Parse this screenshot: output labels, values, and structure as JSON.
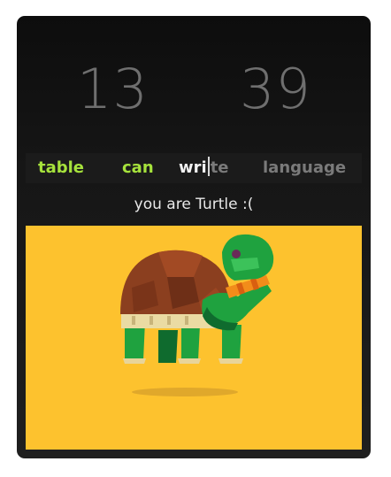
{
  "stats": {
    "left_value": "13",
    "right_value": "39"
  },
  "words": {
    "done": [
      "table",
      "can"
    ],
    "current_typed": "wri",
    "current_remaining": "te",
    "upcoming": "language"
  },
  "result": {
    "message": "you are Turtle :("
  },
  "illustration": {
    "icon": "turtle-icon",
    "background_color": "#fdc22e"
  },
  "colors": {
    "done_word": "#a6e23c",
    "pending_word": "#7a7a7a",
    "stat_number": "#6f6f6f"
  }
}
